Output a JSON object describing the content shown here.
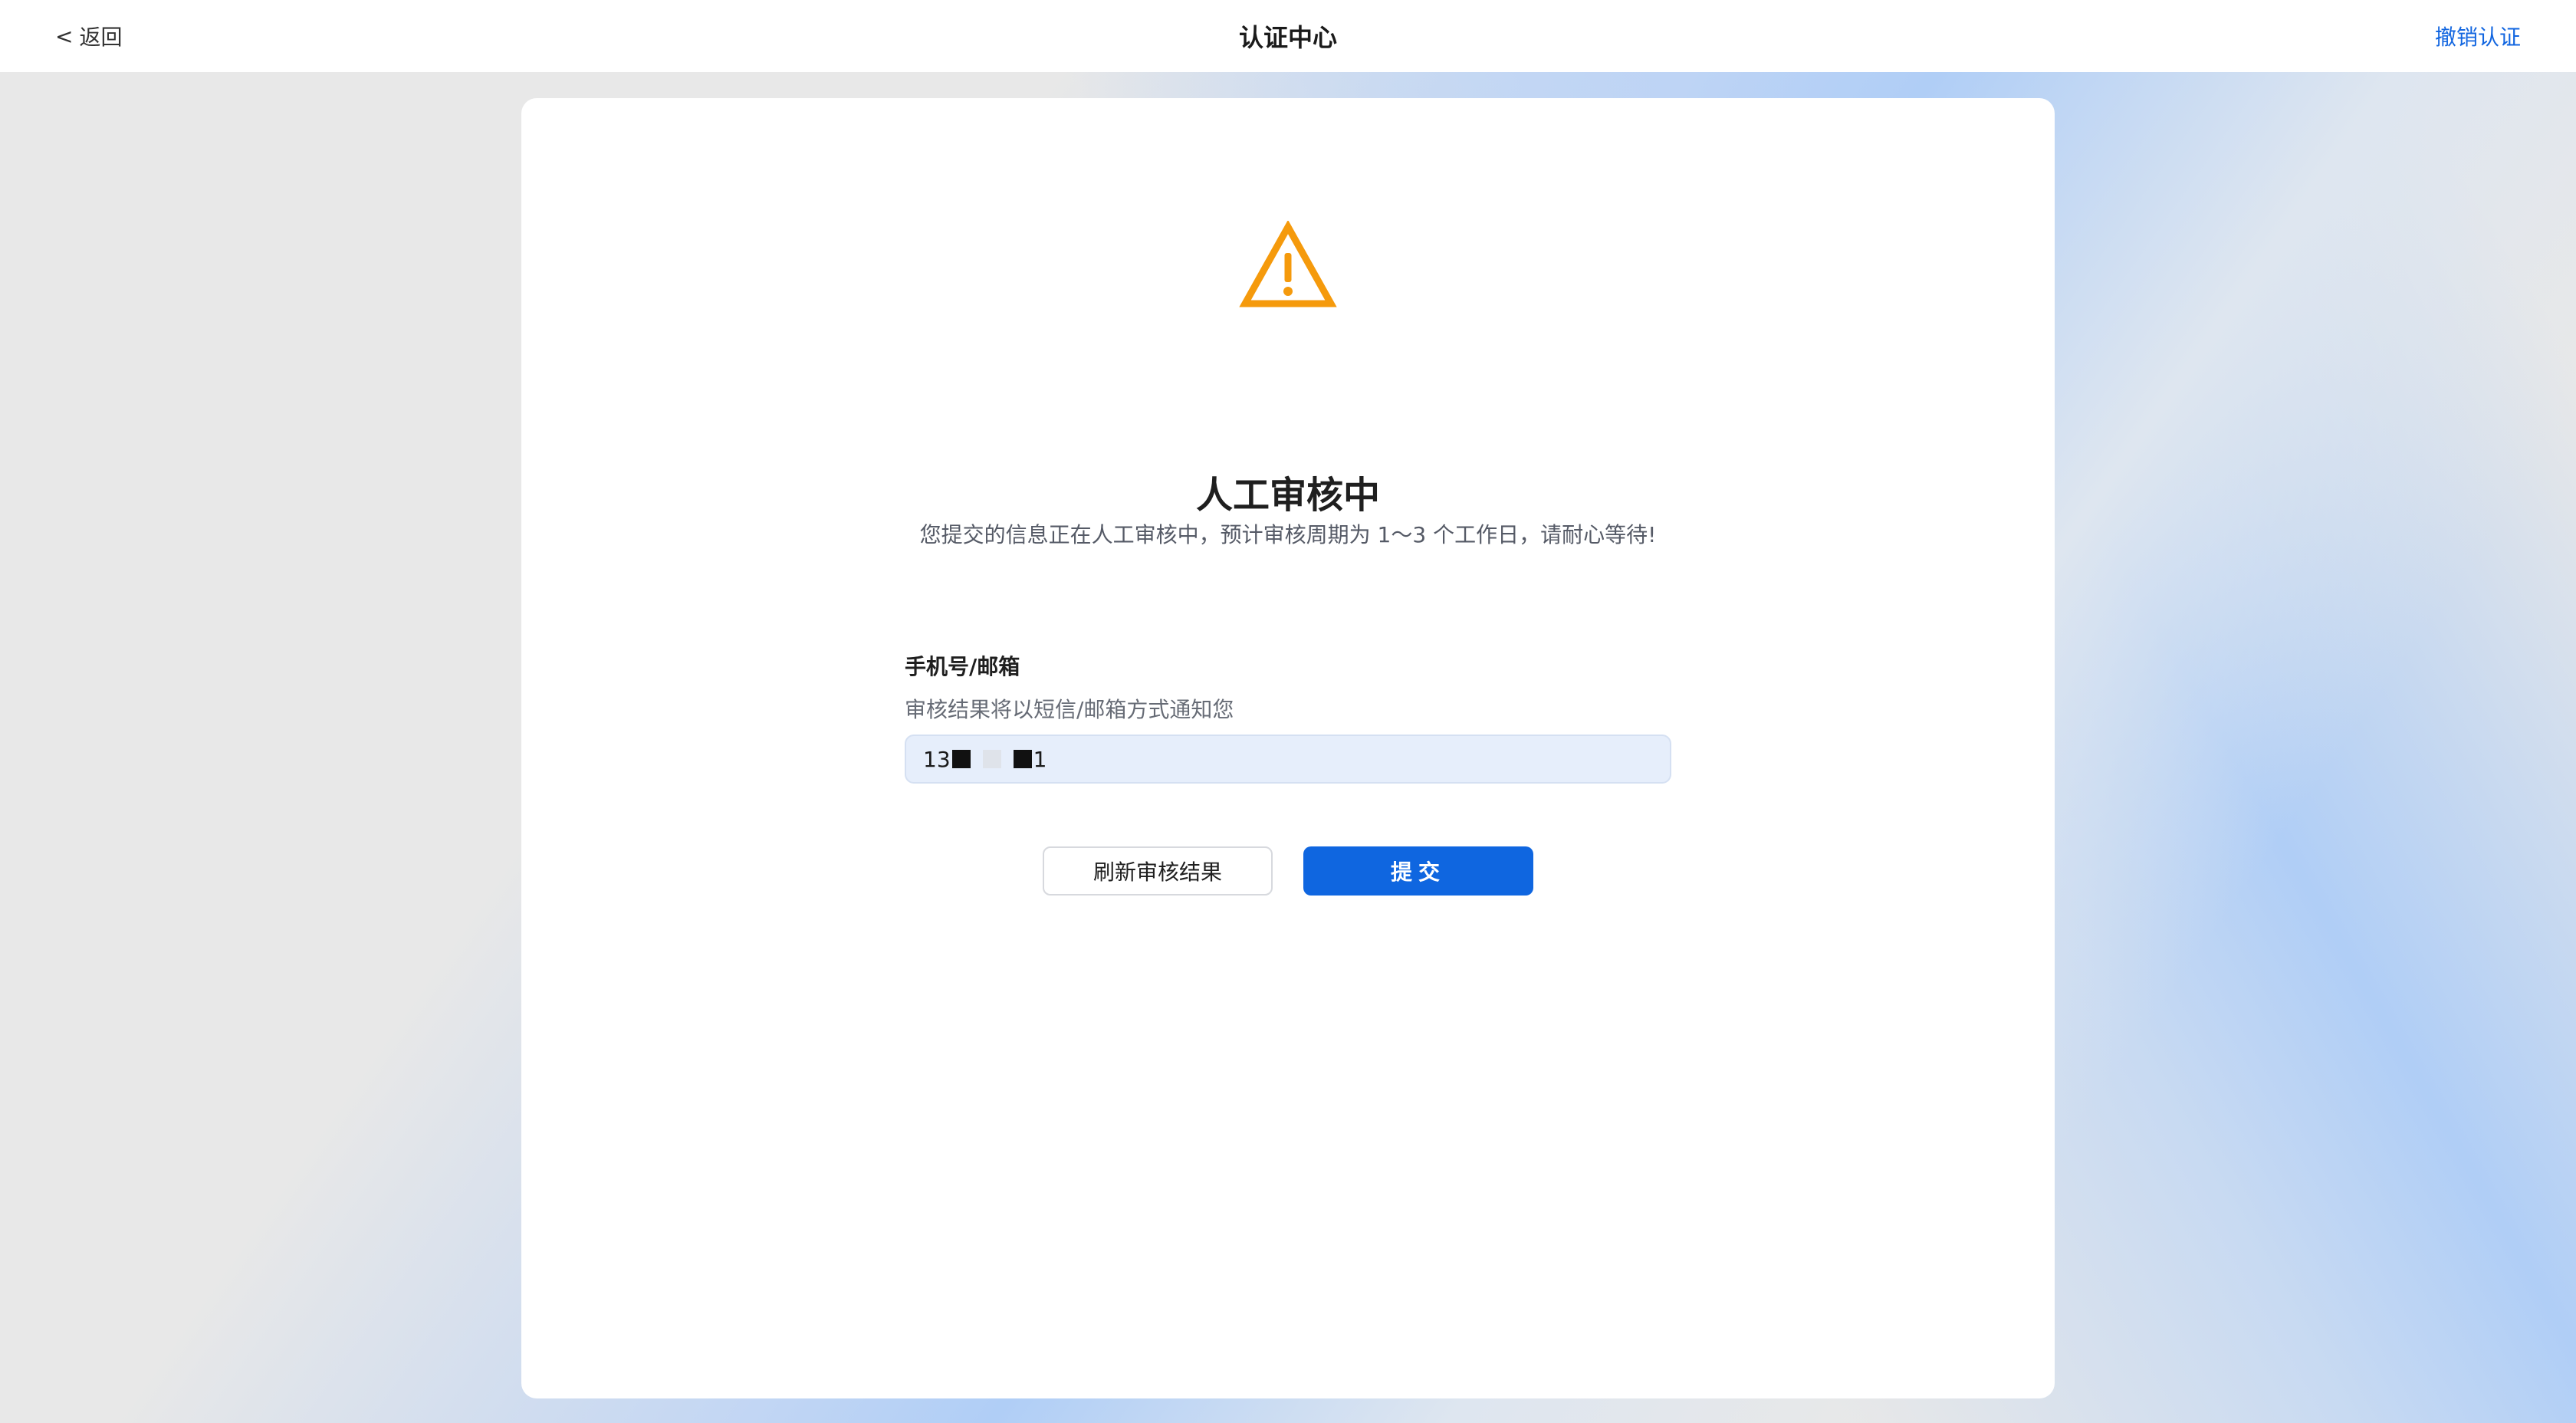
{
  "header": {
    "back_label": "返回",
    "back_chevron": "<",
    "title": "认证中心",
    "revoke_label": "撤销认证"
  },
  "status": {
    "icon": "warning-triangle-icon",
    "icon_color": "#F59A0C",
    "title": "人工审核中",
    "description": "您提交的信息正在人工审核中，预计审核周期为 1～3 个工作日，请耐心等待!"
  },
  "contact_field": {
    "label": "手机号/邮箱",
    "hint": "审核结果将以短信/邮箱方式通知您",
    "value_prefix": "13",
    "value_suffix": "1"
  },
  "actions": {
    "refresh_label": "刷新审核结果",
    "submit_label": "提交"
  },
  "colors": {
    "accent": "#0F66E0",
    "warning": "#F59A0C",
    "input_bg": "#E6EEFB"
  }
}
